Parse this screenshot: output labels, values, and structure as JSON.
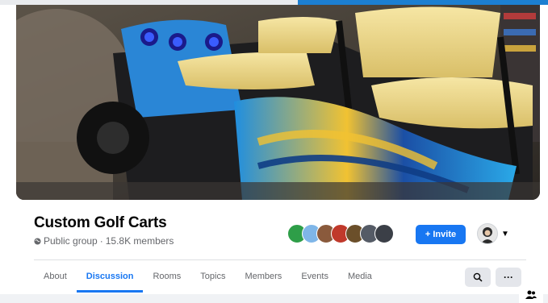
{
  "group": {
    "name": "Custom Golf Carts",
    "privacy": "Public group",
    "separator": "·",
    "member_count": "15.8K members"
  },
  "actions": {
    "invite_label": "+ Invite"
  },
  "tabs": [
    {
      "label": "About"
    },
    {
      "label": "Discussion"
    },
    {
      "label": "Rooms"
    },
    {
      "label": "Topics"
    },
    {
      "label": "Members"
    },
    {
      "label": "Events"
    },
    {
      "label": "Media"
    }
  ],
  "active_tab": "Discussion",
  "more_label": "···",
  "colors": {
    "accent": "#1877f2",
    "seat": "#f3dc8a",
    "body_blue": "#1f8ee0"
  }
}
